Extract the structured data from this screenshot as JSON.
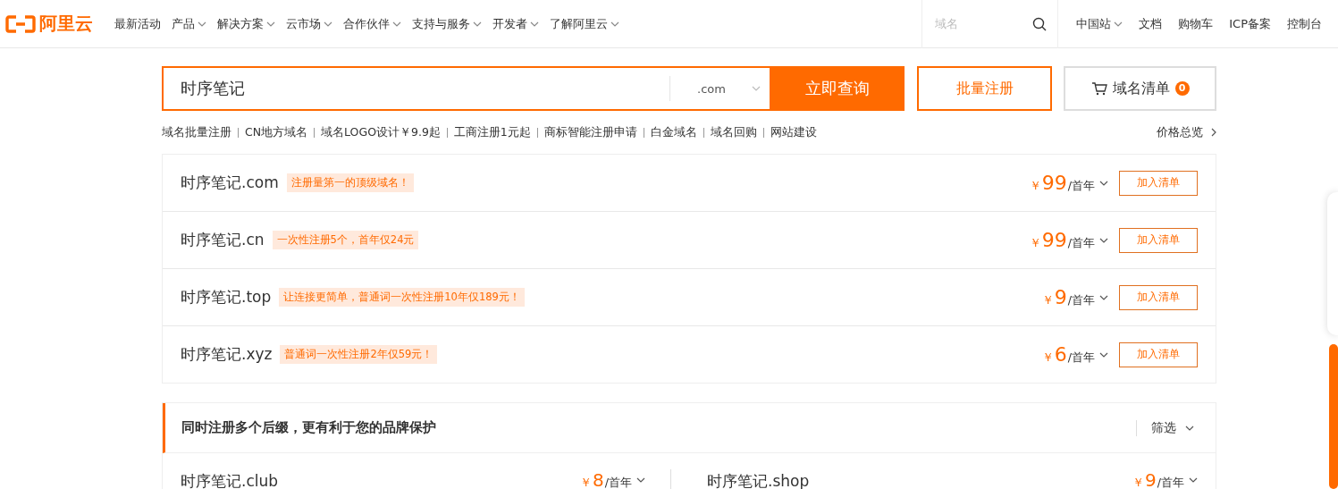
{
  "header": {
    "logo": "阿里云",
    "nav": [
      {
        "label": "最新活动",
        "dropdown": false
      },
      {
        "label": "产品",
        "dropdown": true
      },
      {
        "label": "解决方案",
        "dropdown": true
      },
      {
        "label": "云市场",
        "dropdown": true
      },
      {
        "label": "合作伙伴",
        "dropdown": true
      },
      {
        "label": "支持与服务",
        "dropdown": true
      },
      {
        "label": "开发者",
        "dropdown": true
      },
      {
        "label": "了解阿里云",
        "dropdown": true
      }
    ],
    "search": {
      "placeholder": "域名"
    },
    "right_links": [
      {
        "label": "中国站",
        "dropdown": true
      },
      {
        "label": "文档",
        "dropdown": false
      },
      {
        "label": "购物车",
        "dropdown": false
      },
      {
        "label": "ICP备案",
        "dropdown": false
      },
      {
        "label": "控制台",
        "dropdown": false
      }
    ]
  },
  "domain_search": {
    "value": "时序笔记",
    "suffix": ".com",
    "search_button": "立即查询",
    "bulk_button": "批量注册",
    "list_button": "域名清单",
    "list_count": "0"
  },
  "quick_links": [
    "域名批量注册",
    "CN地方域名",
    "域名LOGO设计￥9.9起",
    "工商注册1元起",
    "商标智能注册申请",
    "白金域名",
    "域名回购",
    "网站建设"
  ],
  "price_overview": "价格总览",
  "results": [
    {
      "domain": "时序笔记.com",
      "promo": "注册量第一的顶级域名！",
      "currency": "￥",
      "price": "99",
      "unit": "/首年",
      "button": "加入清单"
    },
    {
      "domain": "时序笔记.cn",
      "promo": "一次性注册5个，首年仅24元",
      "currency": "￥",
      "price": "99",
      "unit": "/首年",
      "button": "加入清单"
    },
    {
      "domain": "时序笔记.top",
      "promo": "让连接更简单，普通词一次性注册10年仅189元！",
      "currency": "￥",
      "price": "9",
      "unit": "/首年",
      "button": "加入清单"
    },
    {
      "domain": "时序笔记.xyz",
      "promo": "普通词一次性注册2年仅59元！",
      "currency": "￥",
      "price": "6",
      "unit": "/首年",
      "button": "加入清单"
    }
  ],
  "multi_suffix": {
    "title": "同时注册多个后缀，更有利于您的品牌保护",
    "filter": "筛选",
    "items": [
      {
        "domain": "时序笔记.club",
        "currency": "￥",
        "price": "8",
        "unit": "/首年"
      },
      {
        "domain": "时序笔记.shop",
        "currency": "￥",
        "price": "9",
        "unit": "/首年"
      }
    ]
  }
}
